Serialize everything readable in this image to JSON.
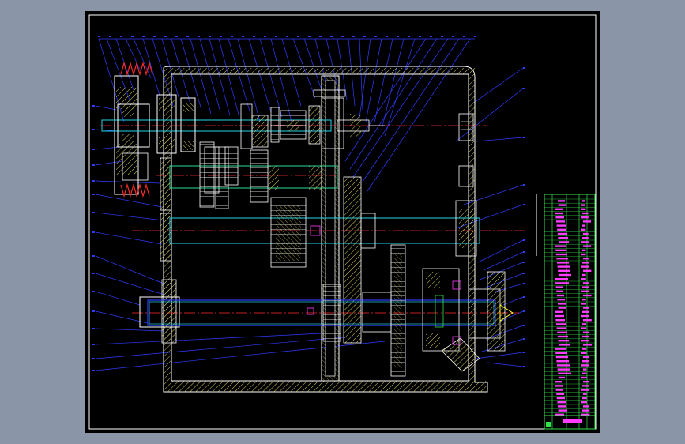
{
  "drawing": {
    "kind": "mechanical assembly drawing (gearbox cross-section)",
    "layer_colors": {
      "outline": "#ffffff",
      "hatch": "#d8d060",
      "leader": "#2f3cff",
      "centerline": "#ff2a2a",
      "shaft": "#23d3e6",
      "green": "#33e14a",
      "magenta": "#ff3cff",
      "yellow": "#ffff33",
      "frame_bg": "#000000",
      "viewport_bg": "#8a96a8"
    }
  }
}
